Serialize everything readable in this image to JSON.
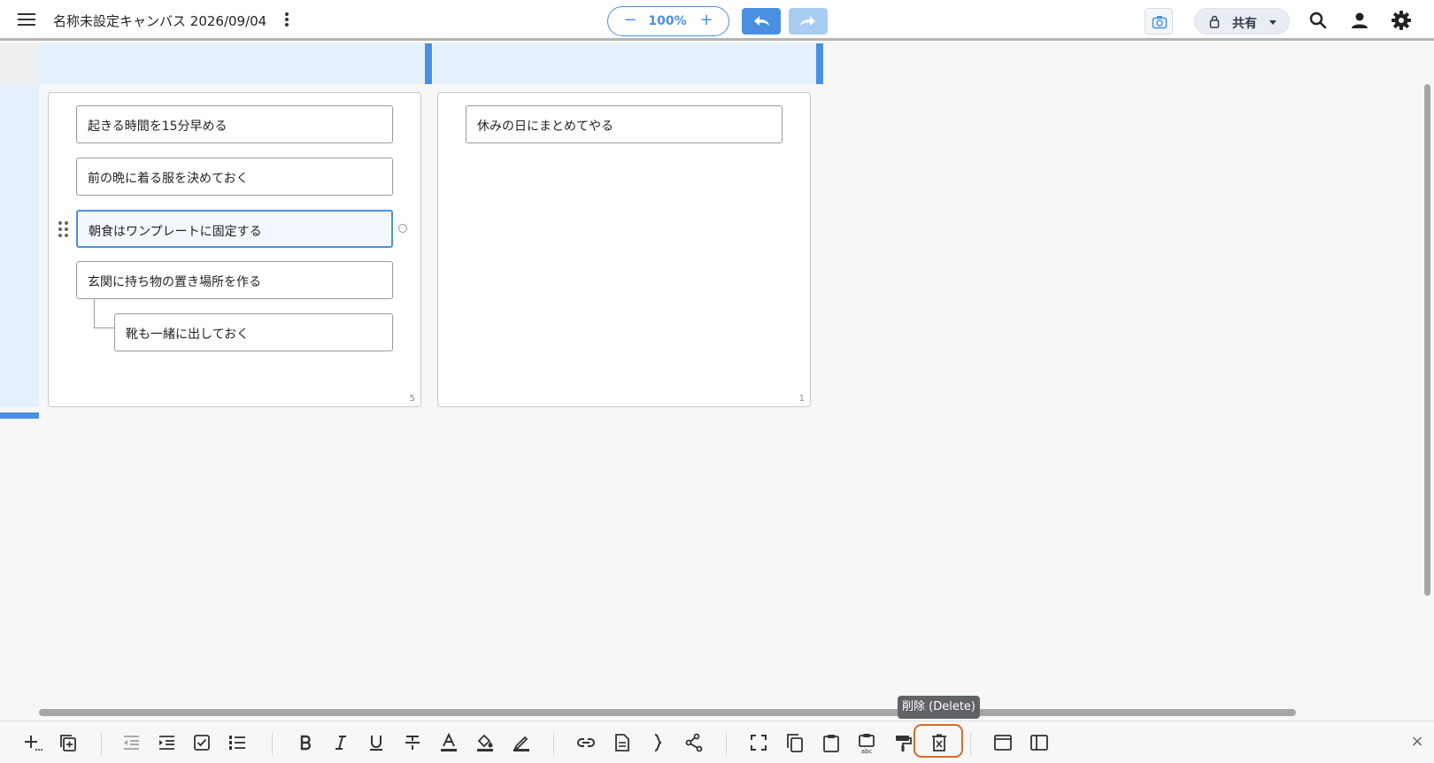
{
  "header": {
    "title": "名称未設定キャンバス 2026/09/04",
    "zoom": {
      "value": "100%",
      "minus": "−",
      "plus": "+"
    },
    "share_label": "共有"
  },
  "canvas": {
    "cells": [
      {
        "count": "5",
        "cards": [
          {
            "text": "起きる時間を15分早める"
          },
          {
            "text": "前の晩に着る服を決めておく"
          },
          {
            "text": "朝食はワンプレートに固定する",
            "selected": true
          },
          {
            "text": "玄関に持ち物の置き場所を作る"
          },
          {
            "text": "靴も一緒に出しておく",
            "indent": 1
          }
        ]
      },
      {
        "count": "1",
        "cards": [
          {
            "text": "休みの日にまとめてやる"
          }
        ]
      }
    ]
  },
  "tooltip": {
    "text": "削除 (Delete)"
  },
  "toolbar": {
    "close": "×",
    "buttons": [
      {
        "icon": "add-card-icon",
        "enabled": true
      },
      {
        "icon": "duplicate-icon",
        "enabled": true
      },
      {
        "icon": "outdent-icon",
        "enabled": false
      },
      {
        "icon": "indent-icon",
        "enabled": true
      },
      {
        "icon": "checkbox-icon",
        "enabled": true
      },
      {
        "icon": "numbered-list-icon",
        "enabled": true
      },
      {
        "icon": "bold-icon",
        "enabled": true
      },
      {
        "icon": "italic-icon",
        "enabled": true
      },
      {
        "icon": "underline-icon",
        "enabled": true
      },
      {
        "icon": "strikethrough-icon",
        "enabled": true
      },
      {
        "icon": "text-color-icon",
        "enabled": true
      },
      {
        "icon": "fill-color-icon",
        "enabled": true
      },
      {
        "icon": "border-color-icon",
        "enabled": true
      },
      {
        "icon": "link-icon",
        "enabled": true
      },
      {
        "icon": "note-icon",
        "enabled": true
      },
      {
        "icon": "brace-icon",
        "enabled": true
      },
      {
        "icon": "share-tree-icon",
        "enabled": true
      },
      {
        "icon": "select-frame-icon",
        "enabled": true
      },
      {
        "icon": "copy-icon",
        "enabled": true
      },
      {
        "icon": "paste-icon",
        "enabled": true
      },
      {
        "icon": "paste-text-icon",
        "enabled": true
      },
      {
        "icon": "format-painter-icon",
        "enabled": true
      },
      {
        "icon": "delete-icon",
        "enabled": true,
        "focused": true
      },
      {
        "icon": "window-icon",
        "enabled": true
      },
      {
        "icon": "sidebar-icon",
        "enabled": true
      }
    ]
  },
  "colors": {
    "accent": "#4a90e2",
    "accent_light": "#a8cdf3",
    "header_band": "#e4f1fc",
    "focus_ring": "#d86a2a",
    "tooltip_bg": "#5f6368"
  }
}
